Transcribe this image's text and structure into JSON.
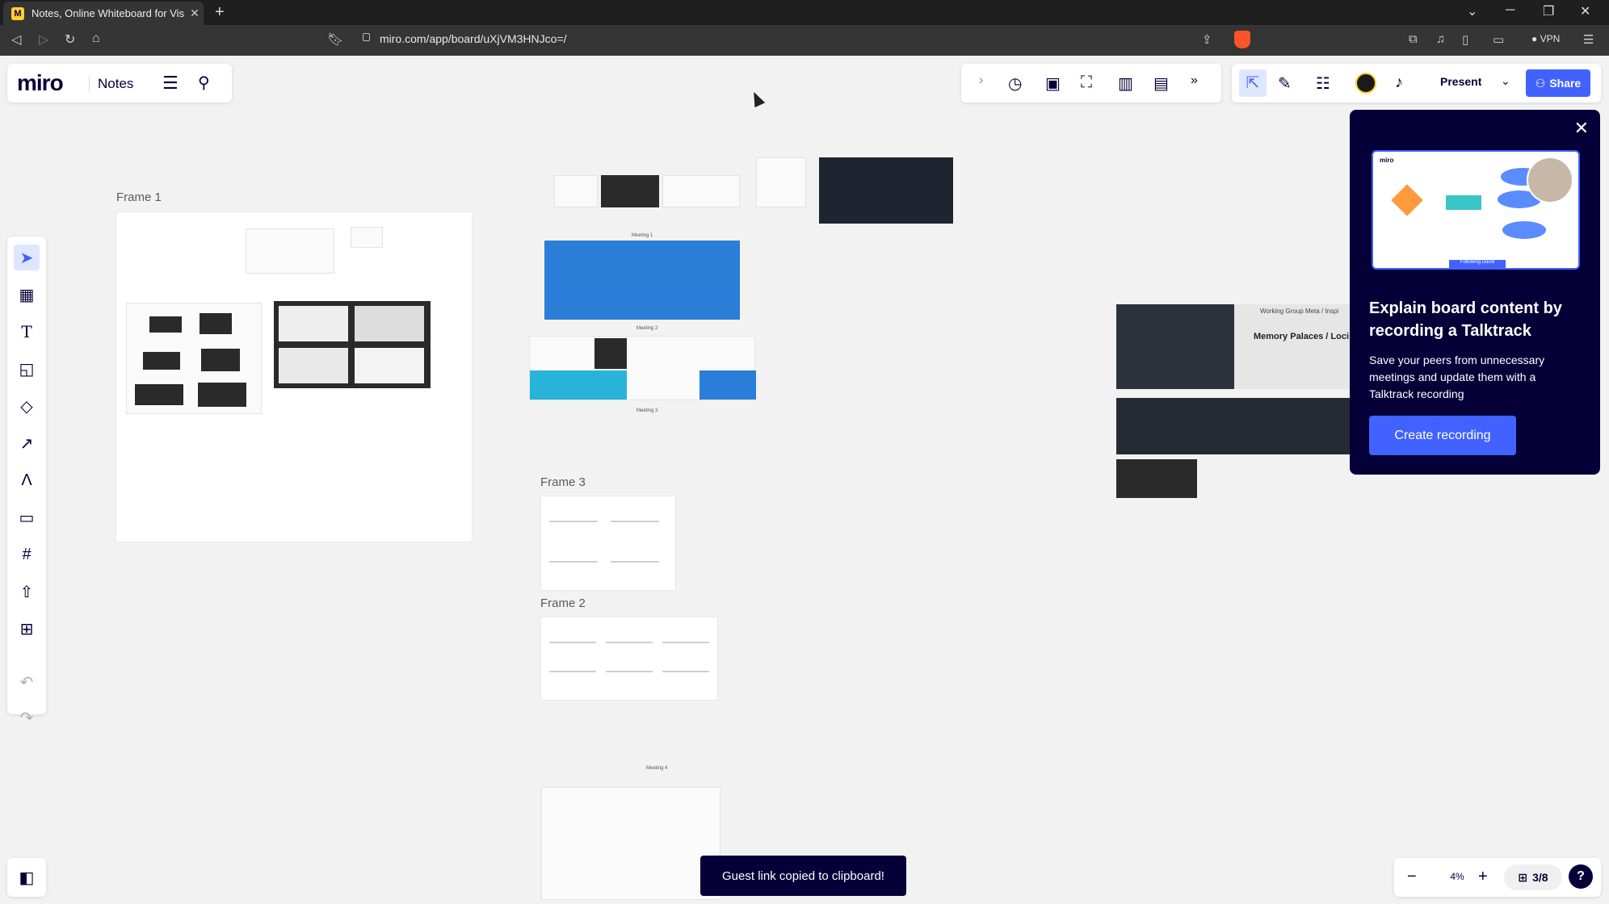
{
  "browser": {
    "tab_title": "Notes, Online Whiteboard for Vis",
    "url": "miro.com/app/board/uXjVM3HNJco=/",
    "vpn_label": "VPN"
  },
  "header": {
    "logo": "miro",
    "board_name": "Notes",
    "present_label": "Present",
    "share_label": "Share"
  },
  "board": {
    "frames": [
      {
        "label": "Frame 1"
      },
      {
        "label": "Frame 3"
      },
      {
        "label": "Frame 2"
      }
    ],
    "meeting_labels": [
      "Meeting 1",
      "Meeting 2",
      "Meeting 3",
      "Meeting 4"
    ],
    "right_cluster_text_1": "Working Group Meta / Inspi",
    "right_cluster_text_2": "Memory Palaces / Loci"
  },
  "popup": {
    "title": "Explain board content by recording a Talktrack",
    "body": "Save your peers from unnecessary meetings and update them with a Talktrack recording",
    "button": "Create recording",
    "preview_logo": "miro",
    "preview_caption": "Following David"
  },
  "zoom": {
    "value": "4%",
    "pages": "3/8"
  },
  "toast": "Guest link copied to clipboard!",
  "colors": {
    "brand_blue": "#4262ff",
    "brand_dark": "#050038",
    "brand_yellow": "#ffd02f"
  }
}
